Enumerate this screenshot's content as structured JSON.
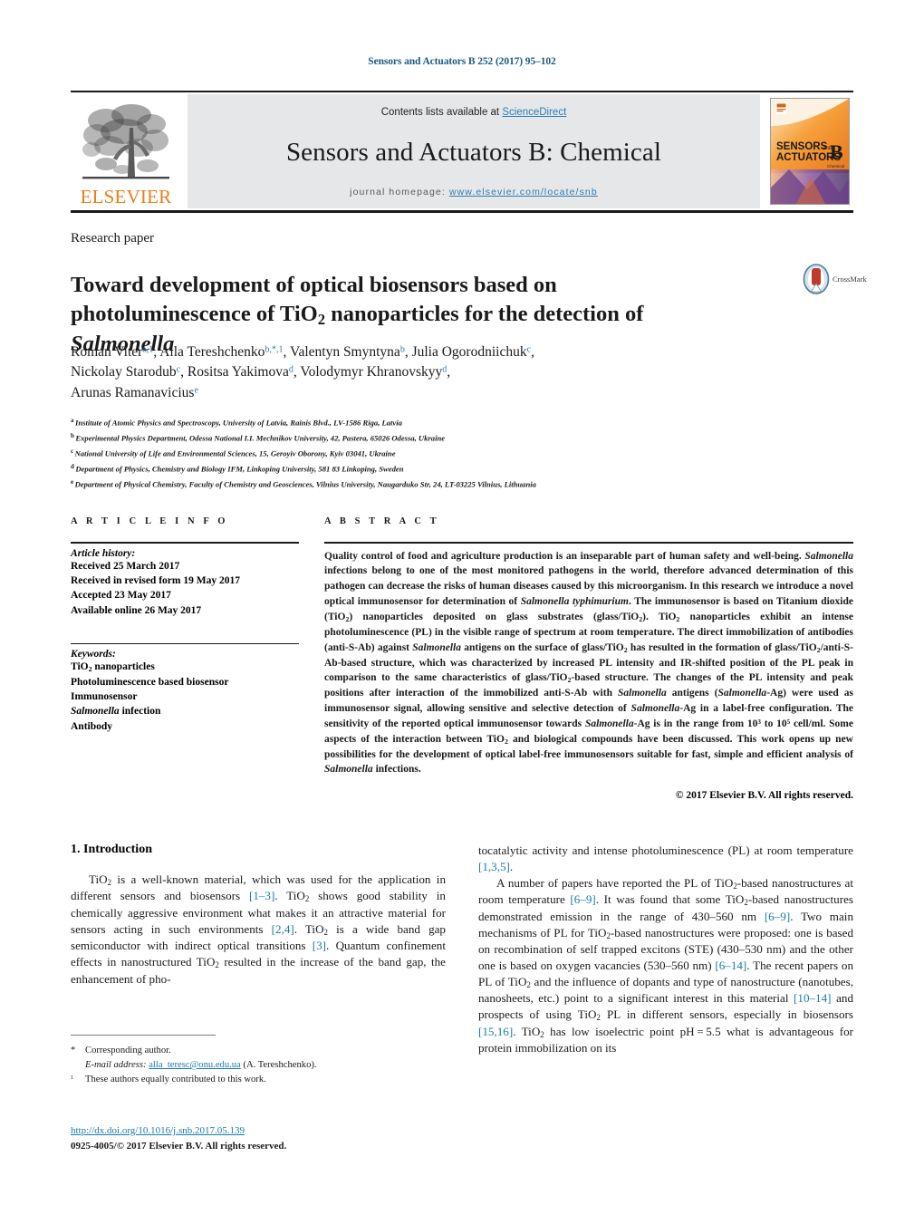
{
  "running_head": "Sensors and Actuators B 252 (2017) 95–102",
  "masthead": {
    "publisher_name": "ELSEVIER",
    "contents_prefix": "Contents lists available at ",
    "contents_link": "ScienceDirect",
    "journal_title": "Sensors and Actuators B: Chemical",
    "homepage_prefix": "journal homepage: ",
    "homepage_url": "www.elsevier.com/locate/snb",
    "cover": {
      "line1": "SENSORS",
      "line1_small": "and",
      "line2": "ACTUATORS",
      "letter": "B",
      "sublabel": "Chemical"
    }
  },
  "article": {
    "type": "Research paper",
    "title_line1": "Toward development of optical biosensors based on",
    "title_line2_a": "photoluminescence of TiO",
    "title_line2_sub": "2",
    "title_line2_b": " nanoparticles for the detection of",
    "title_line3_italic": "Salmonella",
    "crossmark_label": "CrossMark"
  },
  "authors": [
    {
      "name": "Roman Viter",
      "marks": "a,1",
      "sep": ", "
    },
    {
      "name": "Alla Tereshchenko",
      "marks": "b,*,1",
      "sep": ", "
    },
    {
      "name": "Valentyn Smyntyna",
      "marks": "b",
      "sep": ", "
    },
    {
      "name": "Julia Ogorodniichuk",
      "marks": "c",
      "sep": ","
    },
    {
      "name": "Nickolay Starodub",
      "marks": "c",
      "sep": ", "
    },
    {
      "name": "Rositsa Yakimova",
      "marks": "d",
      "sep": ", "
    },
    {
      "name": "Volodymyr Khranovskyy",
      "marks": "d",
      "sep": ","
    },
    {
      "name": "Arunas Ramanavicius",
      "marks": "e",
      "sep": ""
    }
  ],
  "affiliations": [
    {
      "mark": "a",
      "text": "Institute of Atomic Physics and Spectroscopy, University of Latvia, Rainis Blvd., LV-1586 Riga, Latvia"
    },
    {
      "mark": "b",
      "text": "Experimental Physics Department, Odessa National I.I. Mechnikov University, 42, Pastera, 65026 Odessa, Ukraine"
    },
    {
      "mark": "c",
      "text": "National University of Life and Environmental Sciences, 15, Geroyiv Oborony, Kyiv 03041, Ukraine"
    },
    {
      "mark": "d",
      "text": "Department of Physics, Chemistry and Biology IFM, Linkoping University, 581 83 Linkoping, Sweden"
    },
    {
      "mark": "e",
      "text": "Department of Physical Chemistry, Faculty of Chemistry and Geosciences, Vilnius University, Naugarduko Str, 24, LT-03225 Vilnius, Lithuania"
    }
  ],
  "article_info": {
    "heading": "A R T I C L E   I N F O",
    "history_label": "Article history:",
    "history": [
      "Received 25 March 2017",
      "Received in revised form 19 May 2017",
      "Accepted 23 May 2017",
      "Available online 26 May 2017"
    ],
    "keywords_label": "Keywords:",
    "keywords": [
      "TiO2 nanoparticles",
      "Photoluminescence based biosensor",
      "Immunosensor",
      "Salmonella infection",
      "Antibody"
    ]
  },
  "abstract": {
    "heading": "A B S T R A C T",
    "copyright": "© 2017 Elsevier B.V. All rights reserved."
  },
  "introduction": {
    "heading": "1.  Introduction"
  },
  "footnotes": {
    "corresponding_mark": "*",
    "corresponding_text": "Corresponding author.",
    "email_label": "E-mail address:",
    "email": "alla_teresc@onu.edu.ua",
    "email_owner": "(A. Tereshchenko).",
    "equal_mark": "1",
    "equal_text": "These authors equally contributed to this work."
  },
  "publication": {
    "doi": "http://dx.doi.org/10.1016/j.snb.2017.05.139",
    "issn_line": "0925-4005/© 2017 Elsevier B.V. All rights reserved."
  },
  "colors": {
    "link": "#1a7ba8",
    "elsevier_orange": "#ef7c17",
    "masthead_bg": "#e6e7e8",
    "runhead": "#1a5a85"
  }
}
